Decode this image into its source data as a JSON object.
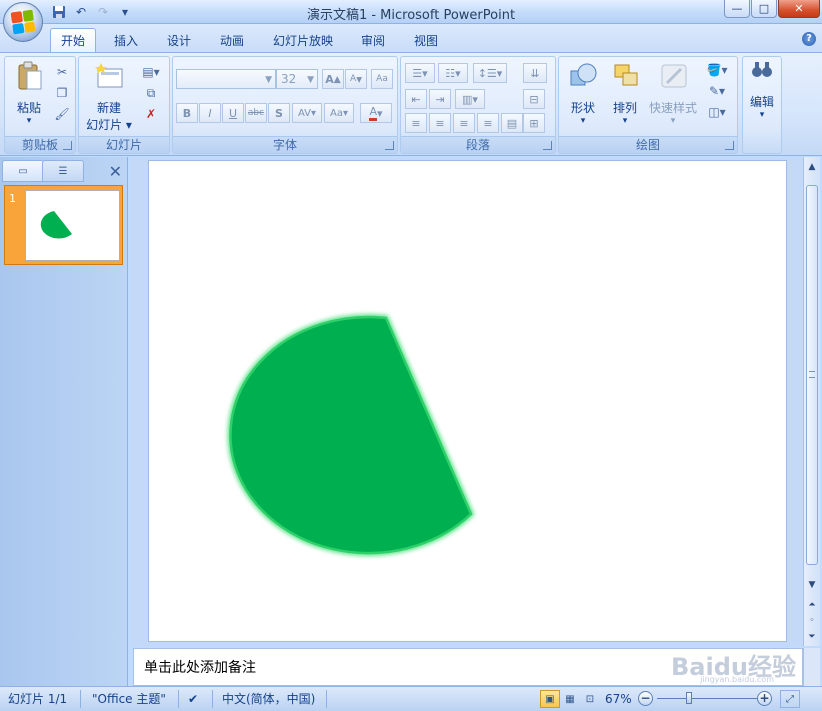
{
  "window": {
    "title": "演示文稿1 - Microsoft PowerPoint",
    "minimize": "—",
    "maximize": "□",
    "close": "✕"
  },
  "qat": {
    "save": "save-icon",
    "undo": "undo-icon",
    "redo": "redo-icon",
    "customize": "▾"
  },
  "tabs": [
    {
      "label": "开始",
      "active": true
    },
    {
      "label": "插入"
    },
    {
      "label": "设计"
    },
    {
      "label": "动画"
    },
    {
      "label": "幻灯片放映"
    },
    {
      "label": "审阅"
    },
    {
      "label": "视图"
    }
  ],
  "help": "?",
  "ribbon": {
    "clipboard": {
      "label": "剪贴板",
      "paste_line1": "粘贴",
      "paste_arrow": "▾"
    },
    "slides": {
      "label": "幻灯片",
      "new_line1": "新建",
      "new_line2": "幻灯片 ▾"
    },
    "font": {
      "label": "字体",
      "font_name": "",
      "font_size": "32",
      "grow": "A",
      "shrink": "A",
      "clear": "Aa",
      "bold": "B",
      "italic": "I",
      "underline": "U",
      "strike": "abc",
      "shadow": "S",
      "spacing": "AV",
      "case": "Aa",
      "color": "A"
    },
    "paragraph": {
      "label": "段落"
    },
    "drawing": {
      "label": "绘图",
      "shapes": "形状",
      "arrange": "排列",
      "quick_styles": "快速样式"
    },
    "editing": {
      "label": "编辑"
    }
  },
  "left_panel": {
    "tab_slides": "slides-tab",
    "tab_outline": "outline-tab",
    "close": "✕",
    "slide_number": "1"
  },
  "slide": {
    "shape": "green half-circle shape",
    "fill_color": "#00b050",
    "stroke_color": "#35d66e"
  },
  "notes": {
    "placeholder": "单击此处添加备注"
  },
  "watermark": {
    "text": "Baidu经验",
    "sub": "jingyan.baidu.com"
  },
  "status": {
    "slide": "幻灯片 1/1",
    "theme": "\"Office 主题\"",
    "language": "中文(简体，中国)",
    "zoom": "67%",
    "zoom_level": 0.67
  }
}
